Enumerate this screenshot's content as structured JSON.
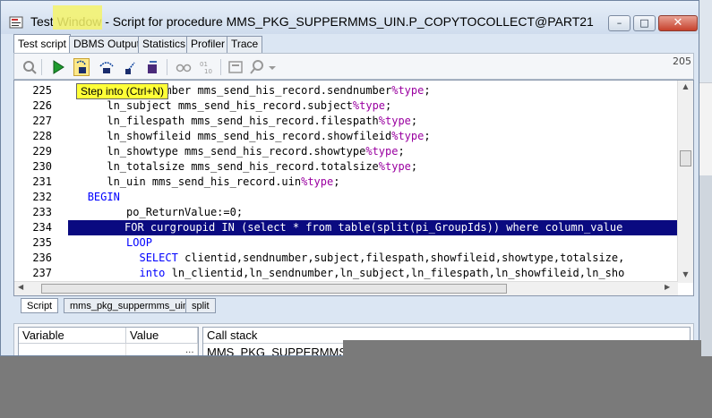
{
  "window": {
    "title": "Test Window - Script for procedure MMS_PKG_SUPPERMMS_UIN.P_COPYTOCOLLECT@PART21",
    "controls": {
      "minimize": "–",
      "maximize": "□",
      "close": "✕"
    }
  },
  "tabs": [
    {
      "label": "Test script",
      "active": true
    },
    {
      "label": "DBMS Output",
      "active": false
    },
    {
      "label": "Statistics",
      "active": false
    },
    {
      "label": "Profiler",
      "active": false
    },
    {
      "label": "Trace",
      "active": false
    }
  ],
  "toolbar": {
    "line_count": "205",
    "icons": [
      "debug-icon",
      "run-icon",
      "step-into-icon",
      "step-over-icon",
      "step-out-icon",
      "run-to-exception-icon",
      "watch-icon",
      "breakpoint-icon",
      "variable-icon",
      "search-icon",
      "dropdown-icon"
    ]
  },
  "tooltip": {
    "text": "Step into (Ctrl+N)"
  },
  "editor": {
    "lines": [
      {
        "num": "225",
        "text": "      ln_sendnumber mms_send_his_record.sendnumber%type;",
        "highlight": false
      },
      {
        "num": "226",
        "text": "      ln_subject mms_send_his_record.subject%type;",
        "highlight": false
      },
      {
        "num": "227",
        "text": "      ln_filespath mms_send_his_record.filespath%type;",
        "highlight": false
      },
      {
        "num": "228",
        "text": "      ln_showfileid mms_send_his_record.showfileid%type;",
        "highlight": false
      },
      {
        "num": "229",
        "text": "      ln_showtype mms_send_his_record.showtype%type;",
        "highlight": false
      },
      {
        "num": "230",
        "text": "      ln_totalsize mms_send_his_record.totalsize%type;",
        "highlight": false
      },
      {
        "num": "231",
        "text": "      ln_uin mms_send_his_record.uin%type;",
        "highlight": false
      },
      {
        "num": "232",
        "text": "   BEGIN",
        "highlight": false
      },
      {
        "num": "233",
        "text": "         po_ReturnValue:=0;",
        "highlight": false
      },
      {
        "num": "234",
        "text": "         FOR curgroupid IN (select * from table(split(pi_GroupIds)) where column_value",
        "highlight": true
      },
      {
        "num": "235",
        "text": "         LOOP",
        "highlight": false
      },
      {
        "num": "236",
        "text": "           SELECT clientid,sendnumber,subject,filespath,showfileid,showtype,totalsize,",
        "highlight": false
      },
      {
        "num": "237",
        "text": "           into ln_clientid,ln_sendnumber,ln_subject,ln_filespath,ln_showfileid,ln_sho",
        "highlight": false
      }
    ]
  },
  "bottom_tabs": [
    {
      "label": "Script",
      "active": true
    },
    {
      "label": "mms_pkg_suppermms_uin",
      "active": false
    },
    {
      "label": "split",
      "active": false
    }
  ],
  "variables": {
    "col_variable": "Variable",
    "col_value": "Value",
    "more": "..."
  },
  "callstack": {
    "header": "Call stack",
    "row": "MMS_PKG_SUPPERMMS"
  }
}
